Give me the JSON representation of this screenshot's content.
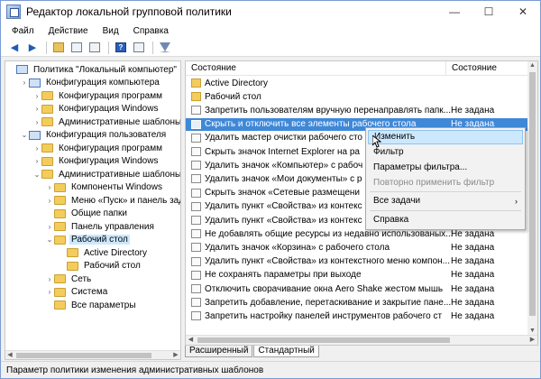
{
  "window": {
    "title": "Редактор локальной групповой политики",
    "minimize": "—",
    "maximize": "☐",
    "close": "✕"
  },
  "menubar": {
    "items": [
      "Файл",
      "Действие",
      "Вид",
      "Справка"
    ]
  },
  "toolbar": {
    "icons": [
      "back-icon",
      "forward-icon",
      "up-folder-icon",
      "show-hide-tree-icon",
      "export-list-icon",
      "help-icon",
      "properties-icon",
      "filter-icon"
    ]
  },
  "tree": {
    "items": [
      {
        "label": "Политика \"Локальный компьютер\"",
        "level": 0,
        "expand": "",
        "kind": "pc"
      },
      {
        "label": "Конфигурация компьютера",
        "level": 1,
        "expand": "›",
        "kind": "pc"
      },
      {
        "label": "Конфигурация программ",
        "level": 2,
        "expand": "›",
        "kind": "folder"
      },
      {
        "label": "Конфигурация Windows",
        "level": 2,
        "expand": "›",
        "kind": "folder"
      },
      {
        "label": "Административные шаблоны",
        "level": 2,
        "expand": "›",
        "kind": "folder"
      },
      {
        "label": "Конфигурация пользователя",
        "level": 1,
        "expand": "⌄",
        "kind": "pc"
      },
      {
        "label": "Конфигурация программ",
        "level": 2,
        "expand": "›",
        "kind": "folder"
      },
      {
        "label": "Конфигурация Windows",
        "level": 2,
        "expand": "›",
        "kind": "folder"
      },
      {
        "label": "Административные шаблоны",
        "level": 2,
        "expand": "⌄",
        "kind": "folder"
      },
      {
        "label": "Компоненты Windows",
        "level": 3,
        "expand": "›",
        "kind": "folder"
      },
      {
        "label": "Меню «Пуск» и панель задач",
        "level": 3,
        "expand": "›",
        "kind": "folder"
      },
      {
        "label": "Общие папки",
        "level": 3,
        "expand": "",
        "kind": "folder"
      },
      {
        "label": "Панель управления",
        "level": 3,
        "expand": "›",
        "kind": "folder"
      },
      {
        "label": "Рабочий стол",
        "level": 3,
        "expand": "⌄",
        "kind": "folder",
        "selected": true
      },
      {
        "label": "Active Directory",
        "level": 4,
        "expand": "",
        "kind": "folder"
      },
      {
        "label": "Рабочий стол",
        "level": 4,
        "expand": "",
        "kind": "folder"
      },
      {
        "label": "Сеть",
        "level": 3,
        "expand": "›",
        "kind": "folder"
      },
      {
        "label": "Система",
        "level": 3,
        "expand": "›",
        "kind": "folder"
      },
      {
        "label": "Все параметры",
        "level": 3,
        "expand": "",
        "kind": "folder"
      }
    ]
  },
  "list": {
    "col_state": "Состояние",
    "col_status": "Состояние",
    "rows": [
      {
        "name": "Active Directory",
        "status": "",
        "kind": "folder"
      },
      {
        "name": "Рабочий стол",
        "status": "",
        "kind": "folder"
      },
      {
        "name": "Запретить пользователям вручную перенаправлять папк...",
        "status": "Не задана",
        "kind": "policy"
      },
      {
        "name": "Скрыть и отключить все элементы рабочего стола",
        "status": "Не задана",
        "kind": "policy",
        "selected": true
      },
      {
        "name": "Удалить мастер очистки рабочего сто",
        "status": "",
        "kind": "policy"
      },
      {
        "name": "Скрыть значок Internet Explorer на ра",
        "status": "",
        "kind": "policy"
      },
      {
        "name": "Удалить значок «Компьютер» с рабоч",
        "status": "",
        "kind": "policy"
      },
      {
        "name": "Удалить значок «Мои документы» с р",
        "status": "",
        "kind": "policy"
      },
      {
        "name": "Скрыть значок «Сетевые размещени",
        "status": "",
        "kind": "policy"
      },
      {
        "name": "Удалить пункт «Свойства» из контекс",
        "status": "",
        "kind": "policy"
      },
      {
        "name": "Удалить пункт «Свойства» из контекс",
        "status": "",
        "kind": "policy"
      },
      {
        "name": "Не добавлять общие ресурсы из недавно использованых...",
        "status": "Не задана",
        "kind": "policy"
      },
      {
        "name": "Удалить значок «Корзина» с рабочего стола",
        "status": "Не задана",
        "kind": "policy"
      },
      {
        "name": "Удалить пункт «Свойства» из контекстного меню компон...",
        "status": "Не задана",
        "kind": "policy"
      },
      {
        "name": "Не сохранять параметры при выходе",
        "status": "Не задана",
        "kind": "policy"
      },
      {
        "name": "Отключить сворачивание окна Aero Shake жестом мышь",
        "status": "Не задана",
        "kind": "policy"
      },
      {
        "name": "Запретить добавление, перетаскивание и закрытие пане...",
        "status": "Не задана",
        "kind": "policy"
      },
      {
        "name": "Запретить настройку панелей инструментов рабочего ст",
        "status": "Не задана",
        "kind": "policy"
      }
    ]
  },
  "tabs": [
    "Расширенный",
    "Стандартный"
  ],
  "statusbar": {
    "text": "Параметр политики изменения административных шаблонов"
  },
  "context_menu": {
    "items": [
      {
        "label": "Изменить",
        "highlight": true
      },
      {
        "label": "Фильтр"
      },
      {
        "label": "Параметры фильтра..."
      },
      {
        "label": "Повторно применить фильтр",
        "disabled": true
      },
      {
        "label": "Все задачи",
        "submenu": "›"
      },
      {
        "label": "Справка"
      }
    ]
  }
}
